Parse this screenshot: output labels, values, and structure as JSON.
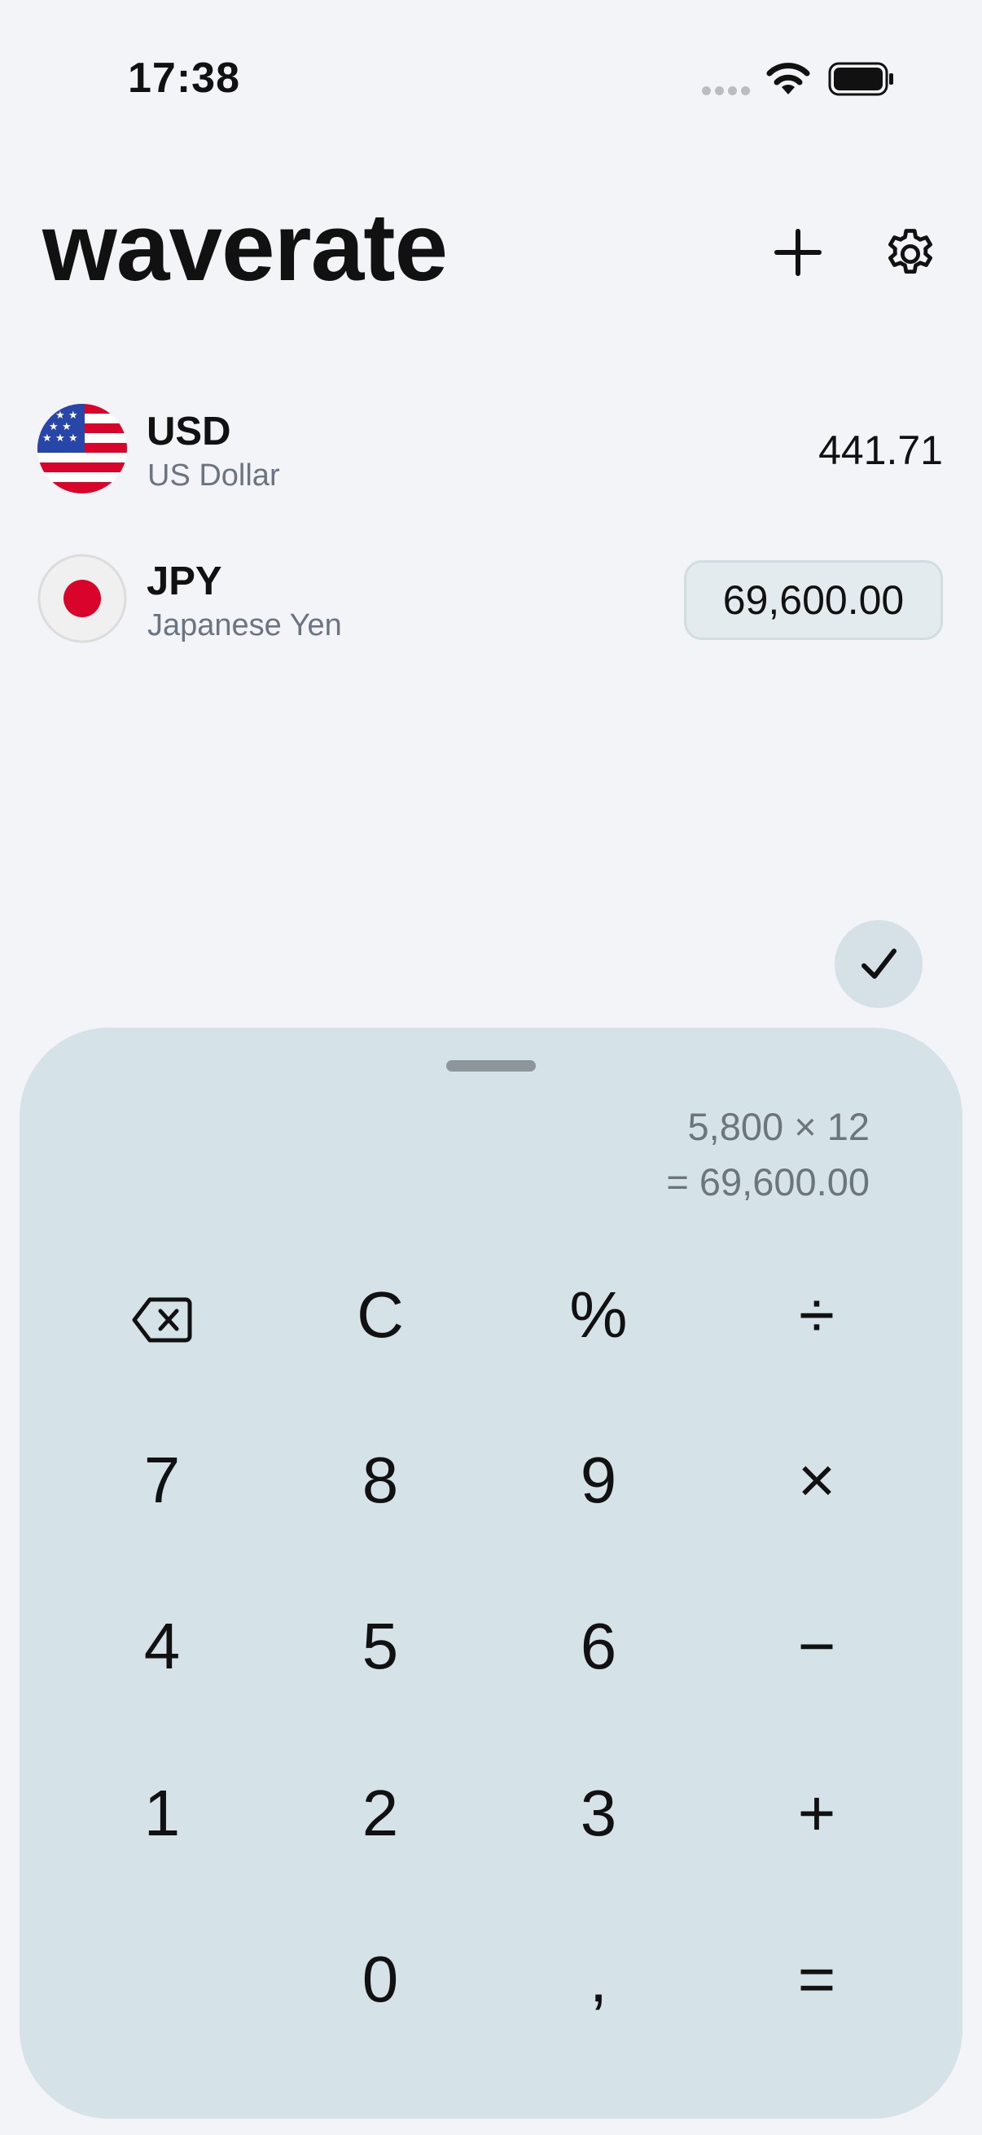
{
  "status_bar": {
    "time": "17:38",
    "battery": "full"
  },
  "header": {
    "title": "waverate",
    "add_icon": "plus-icon",
    "settings_icon": "gear-icon"
  },
  "currencies": [
    {
      "code": "USD",
      "name": "US Dollar",
      "amount": "441.71",
      "flag": "us-flag"
    },
    {
      "code": "JPY",
      "name": "Japanese Yen",
      "amount": "69,600.00",
      "flag": "japan-flag",
      "active": true
    }
  ],
  "confirm": {
    "icon": "checkmark-icon"
  },
  "calculator": {
    "expression": "5,800 × 12",
    "result": "= 69,600.00",
    "keys": [
      [
        "backspace",
        "C",
        "%",
        "÷"
      ],
      [
        "7",
        "8",
        "9",
        "×"
      ],
      [
        "4",
        "5",
        "6",
        "−"
      ],
      [
        "1",
        "2",
        "3",
        "+"
      ],
      [
        "",
        "0",
        ",",
        "="
      ]
    ]
  },
  "colors": {
    "background": "#f2f4f7",
    "sheet": "#d5e2e8",
    "muted_text": "#6b7480",
    "flag_red": "#d90429"
  }
}
